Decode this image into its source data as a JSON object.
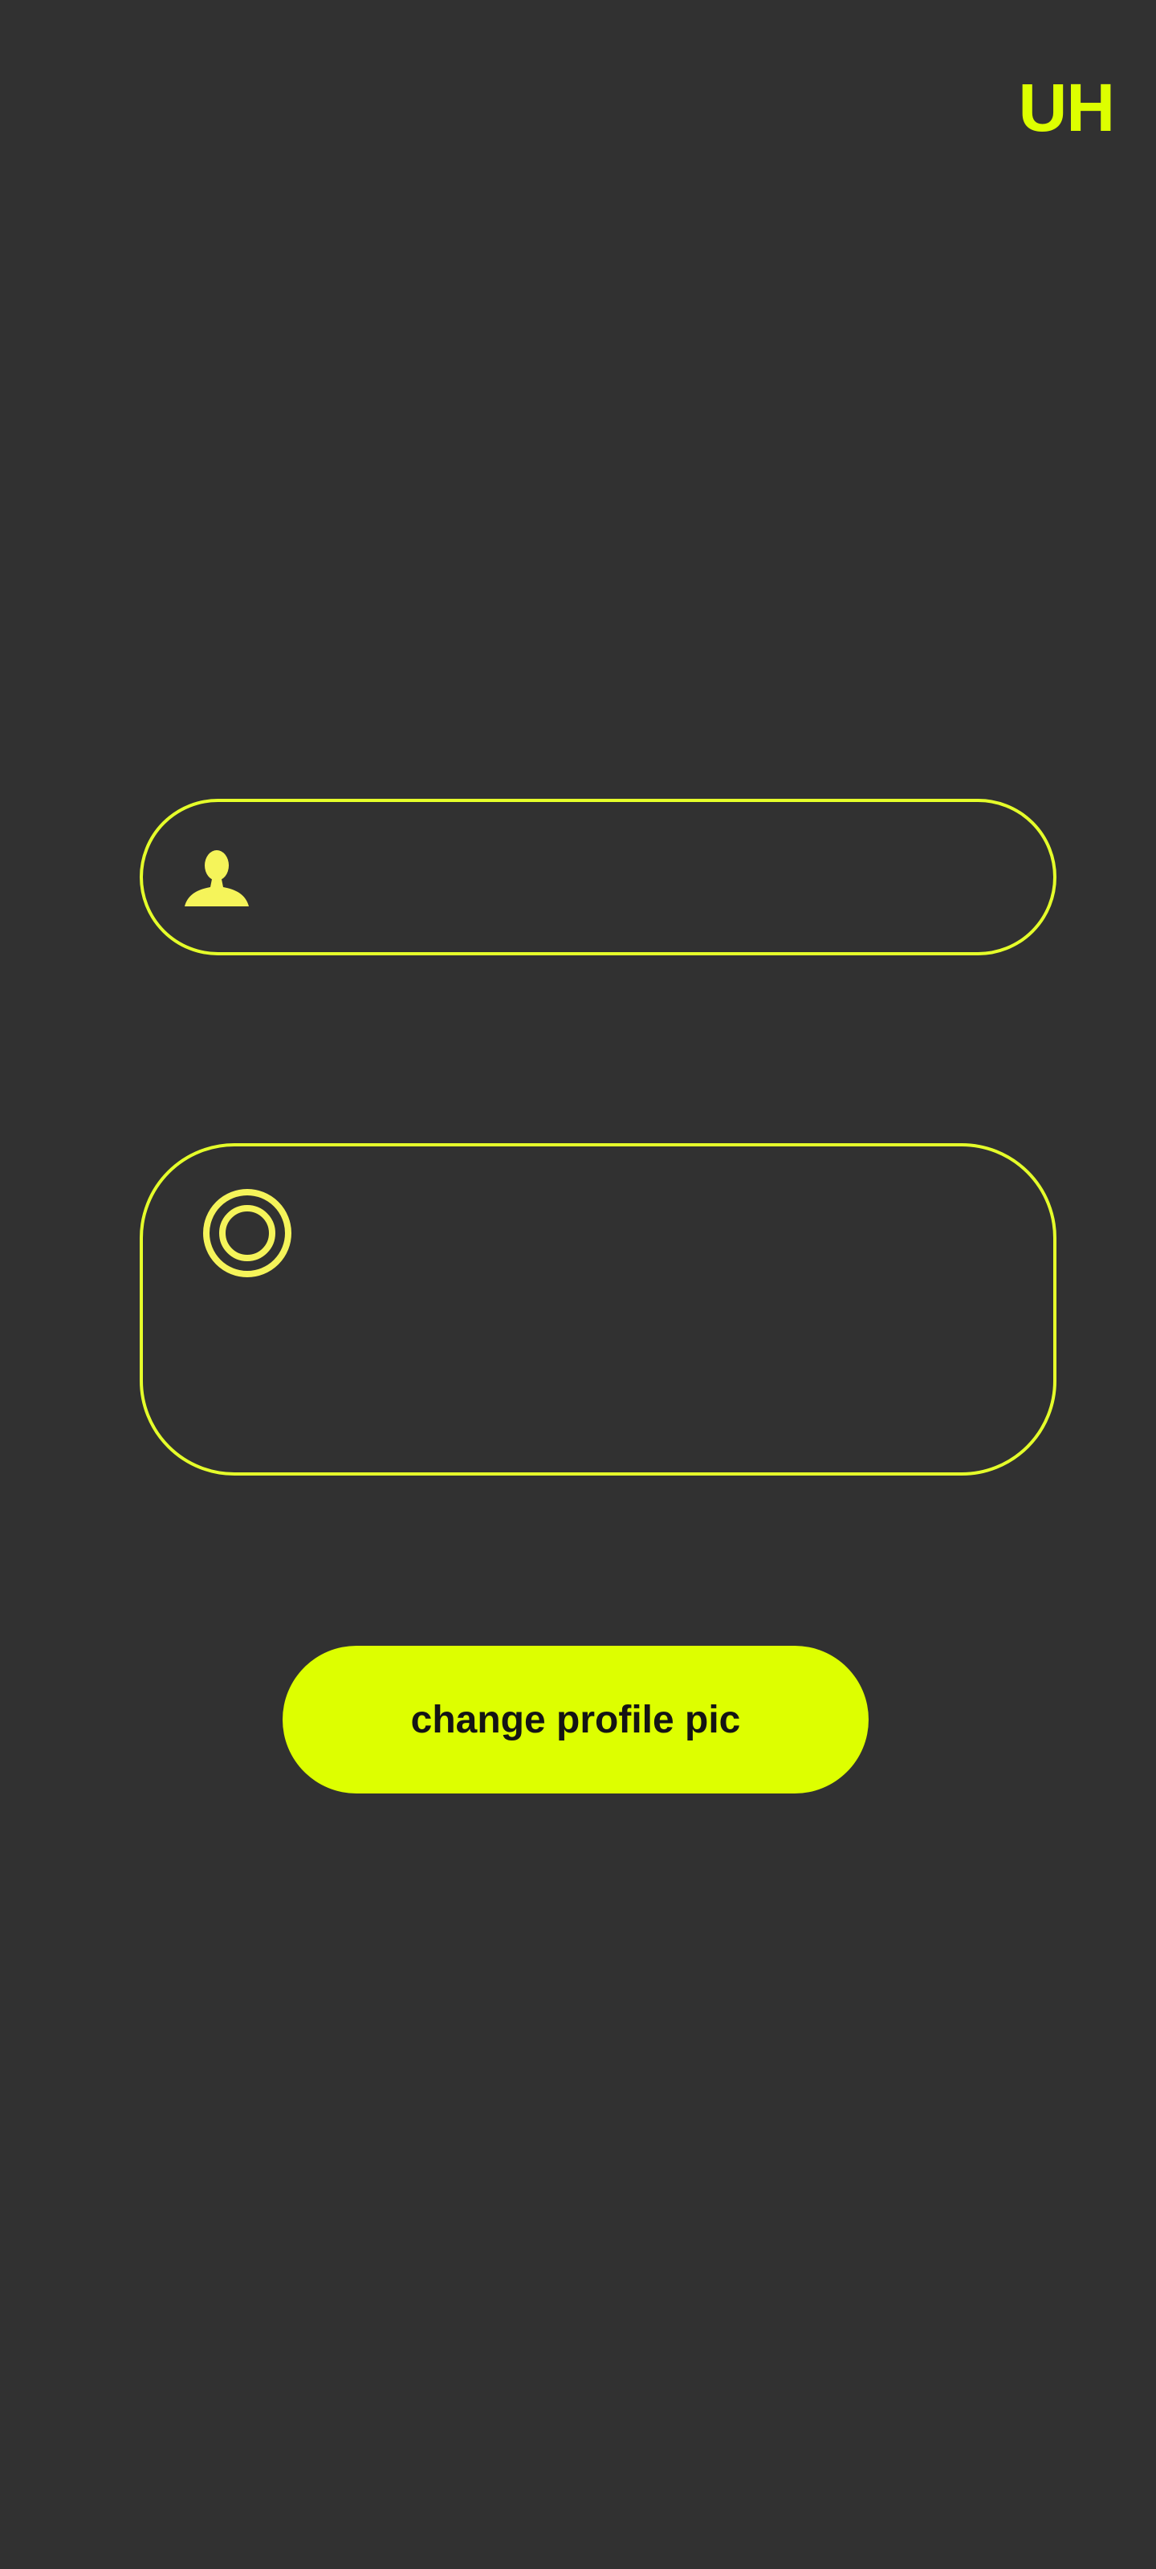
{
  "header": {
    "logo_text": "UH"
  },
  "form": {
    "name_field": {
      "value": "",
      "icon": "user-icon"
    },
    "bio_field": {
      "value": "",
      "icon": "record-icon"
    },
    "change_pic_label": "change profile pic"
  },
  "colors": {
    "background": "#313131",
    "accent": "#DDFF00",
    "outline": "#E5FF2A",
    "button_text": "#141414"
  }
}
